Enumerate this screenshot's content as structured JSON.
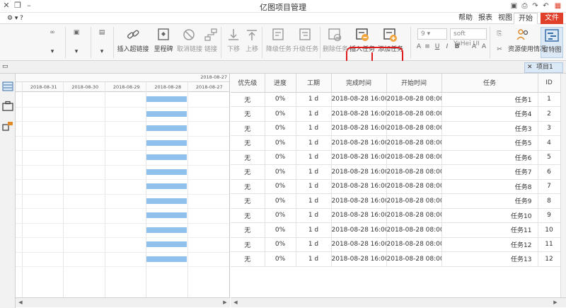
{
  "window": {
    "title": "亿图项目管理"
  },
  "menu": {
    "file": "文件",
    "tabs": [
      "开始",
      "视图",
      "报表",
      "帮助"
    ]
  },
  "ribbon": {
    "gantt_view": "甘特图",
    "resource_usage": "资源使用情况",
    "font_name": "soft YaHei UI",
    "font_size": "9",
    "add_task": "添加任务",
    "insert_task": "插入任务",
    "delete_task": "删除任务",
    "indent_task": "升级任务",
    "outdent_task": "降级任务",
    "move_up": "上移",
    "move_down": "下移",
    "link": "链接",
    "unlink": "取消链接",
    "milestone": "里程碑",
    "insert_hyperlink": "插入超链接"
  },
  "doc_tab": {
    "label": "项目1"
  },
  "table": {
    "columns": [
      "ID",
      "任务",
      "开始时间",
      "完成时间",
      "工期",
      "进度",
      "优先级"
    ],
    "rows": [
      {
        "id": "1",
        "task": "任务1",
        "start": "2018-08-28 08:00",
        "finish": "2018-08-28 16:00",
        "duration": "1 d",
        "progress": "0%",
        "priority": "无"
      },
      {
        "id": "2",
        "task": "任务4",
        "start": "2018-08-28 08:00",
        "finish": "2018-08-28 16:00",
        "duration": "1 d",
        "progress": "0%",
        "priority": "无"
      },
      {
        "id": "3",
        "task": "任务3",
        "start": "2018-08-28 08:00",
        "finish": "2018-08-28 16:00",
        "duration": "1 d",
        "progress": "0%",
        "priority": "无"
      },
      {
        "id": "4",
        "task": "任务5",
        "start": "2018-08-28 08:00",
        "finish": "2018-08-28 16:00",
        "duration": "1 d",
        "progress": "0%",
        "priority": "无"
      },
      {
        "id": "5",
        "task": "任务6",
        "start": "2018-08-28 08:00",
        "finish": "2018-08-28 16:00",
        "duration": "1 d",
        "progress": "0%",
        "priority": "无"
      },
      {
        "id": "6",
        "task": "任务7",
        "start": "2018-08-28 08:00",
        "finish": "2018-08-28 16:00",
        "duration": "1 d",
        "progress": "0%",
        "priority": "无"
      },
      {
        "id": "7",
        "task": "任务8",
        "start": "2018-08-28 08:00",
        "finish": "2018-08-28 16:00",
        "duration": "1 d",
        "progress": "0%",
        "priority": "无"
      },
      {
        "id": "8",
        "task": "任务9",
        "start": "2018-08-28 08:00",
        "finish": "2018-08-28 16:00",
        "duration": "1 d",
        "progress": "0%",
        "priority": "无"
      },
      {
        "id": "9",
        "task": "任务10",
        "start": "2018-08-28 08:00",
        "finish": "2018-08-28 16:00",
        "duration": "1 d",
        "progress": "0%",
        "priority": "无"
      },
      {
        "id": "10",
        "task": "任务11",
        "start": "2018-08-28 08:00",
        "finish": "2018-08-28 16:00",
        "duration": "1 d",
        "progress": "0%",
        "priority": "无"
      },
      {
        "id": "11",
        "task": "任务12",
        "start": "2018-08-28 08:00",
        "finish": "2018-08-28 16:00",
        "duration": "1 d",
        "progress": "0%",
        "priority": "无"
      },
      {
        "id": "12",
        "task": "任务13",
        "start": "2018-08-28 08:00",
        "finish": "2018-08-28 16:00",
        "duration": "1 d",
        "progress": "0%",
        "priority": "无"
      }
    ]
  },
  "gantt": {
    "week_label": "2018-08-27",
    "dates": [
      "2018-08-27",
      "2018-08-28",
      "2018-08-29",
      "2018-08-30",
      "2018-08-31"
    ]
  },
  "colors": {
    "accent": "#e03f2a",
    "highlight": "#e01b1b",
    "gantt_bar": "#8fc1ec"
  }
}
